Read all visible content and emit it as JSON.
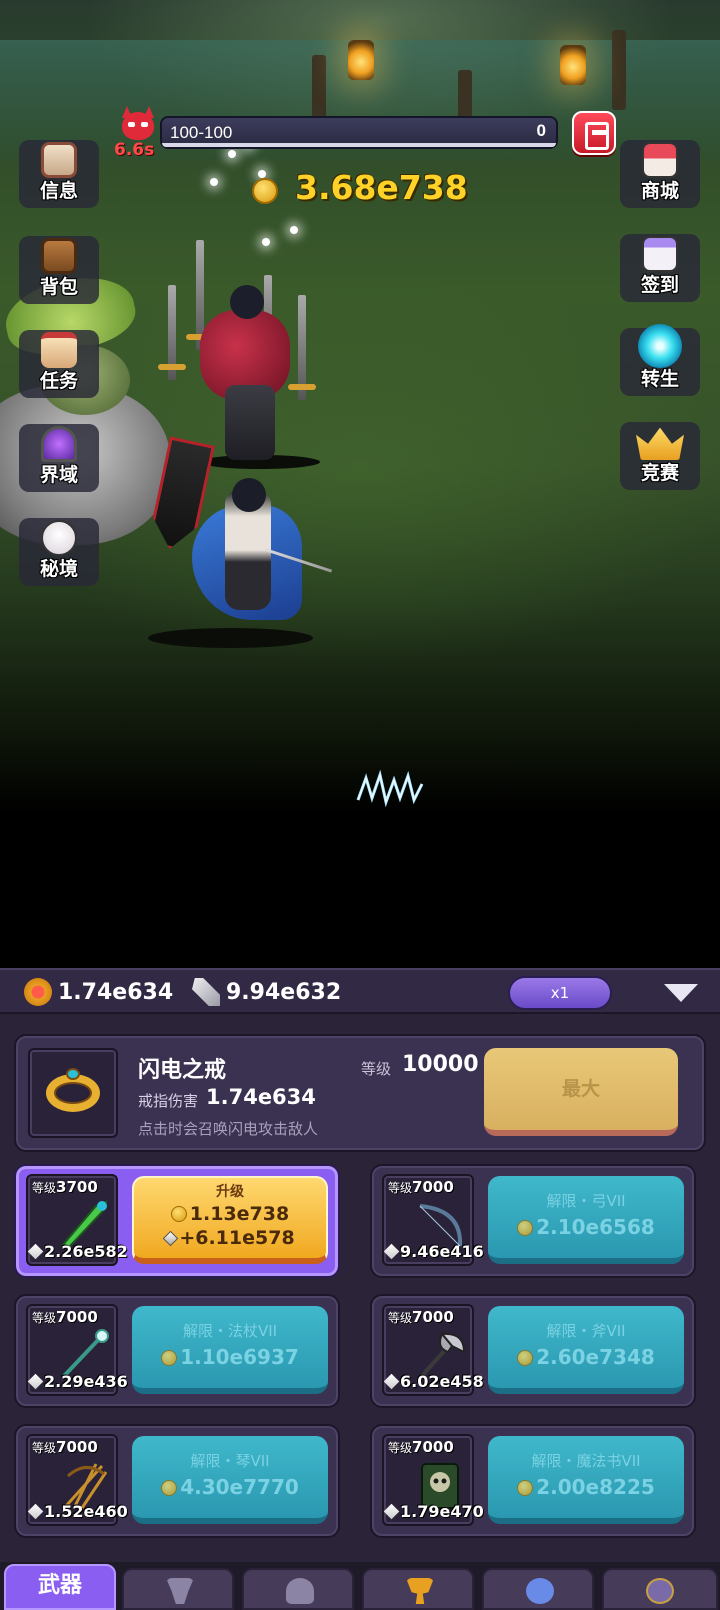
{
  "hud": {
    "stage": "100-100",
    "kill_count": "0",
    "timer": "6.6s",
    "gold": "3.68e738",
    "stage_progress": 1.0
  },
  "left_menu": [
    {
      "label": "信息",
      "icon": "clipboard-icon"
    },
    {
      "label": "背包",
      "icon": "backpack-icon"
    },
    {
      "label": "任务",
      "icon": "scroll-icon"
    },
    {
      "label": "界域",
      "icon": "portal-icon"
    },
    {
      "label": "秘境",
      "icon": "skull-icon"
    }
  ],
  "right_menu": [
    {
      "label": "商城",
      "icon": "shop-icon"
    },
    {
      "label": "签到",
      "icon": "calendar-icon"
    },
    {
      "label": "转生",
      "icon": "vortex-icon"
    },
    {
      "label": "竞赛",
      "icon": "crown-icon"
    }
  ],
  "stats": {
    "ring_power": "1.74e634",
    "weapon_power": "9.94e632",
    "speed": "x1"
  },
  "ring": {
    "name": "闪电之戒",
    "level_label": "等级",
    "level": "10000",
    "damage_label": "戒指伤害",
    "damage": "1.74e634",
    "description": "点击时会召唤闪电攻击敌人",
    "button": "最大"
  },
  "weapons": [
    {
      "level_label": "等级",
      "level": "3700",
      "damage": "2.26e582",
      "type": "upgrade",
      "button_title": "升级",
      "cost": "1.13e738",
      "gain": "+6.11e578",
      "icon": "green-blade-icon"
    },
    {
      "level_label": "等级",
      "level": "7000",
      "damage": "9.46e416",
      "type": "unlock",
      "button_title": "解限・弓VII",
      "cost": "2.10e6568",
      "icon": "bow-icon"
    },
    {
      "level_label": "等级",
      "level": "7000",
      "damage": "2.29e436",
      "type": "unlock",
      "button_title": "解限・法杖VII",
      "cost": "1.10e6937",
      "icon": "staff-icon"
    },
    {
      "level_label": "等级",
      "level": "7000",
      "damage": "6.02e458",
      "type": "unlock",
      "button_title": "解限・斧VII",
      "cost": "2.60e7348",
      "icon": "axe-icon"
    },
    {
      "level_label": "等级",
      "level": "7000",
      "damage": "1.52e460",
      "type": "unlock",
      "button_title": "解限・琴VII",
      "cost": "4.30e7770",
      "icon": "harp-icon"
    },
    {
      "level_label": "等级",
      "level": "7000",
      "damage": "1.79e470",
      "type": "unlock",
      "button_title": "解限・魔法书VII",
      "cost": "2.00e8225",
      "icon": "spellbook-icon"
    }
  ],
  "tabs": [
    {
      "label": "武器",
      "active": true
    },
    {
      "icon": "anvil-icon"
    },
    {
      "icon": "helmet-icon"
    },
    {
      "icon": "trophy-icon"
    },
    {
      "icon": "gem-icon"
    },
    {
      "icon": "sword-emblem-icon"
    }
  ],
  "colors": {
    "gold": "#ffd228",
    "accent_purple": "#8a5ef0",
    "unlock_teal": "#40b8cc",
    "max_button": "#e8c878",
    "timer_red": "#ff4a4a"
  }
}
